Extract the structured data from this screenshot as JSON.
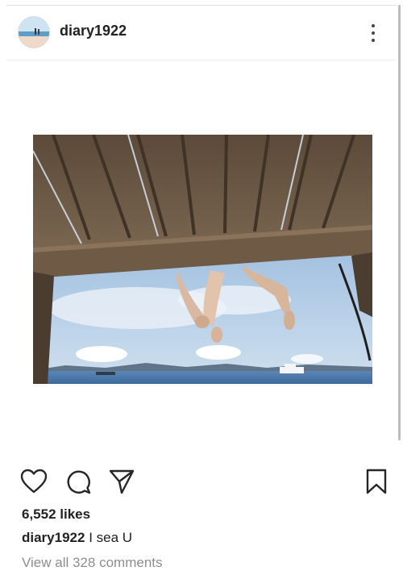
{
  "post": {
    "username": "diary1922",
    "likes_text": "6,552 likes",
    "caption_user": "diary1922",
    "caption_text": "I sea U",
    "view_comments": "View all 328 comments"
  },
  "icons": {
    "more": "more-vertical-icon",
    "like": "heart-icon",
    "comment": "comment-icon",
    "share": "send-icon",
    "save": "bookmark-icon"
  },
  "colors": {
    "text": "#262626",
    "secondary_text": "#8e8e8e",
    "divider": "#efefef"
  }
}
